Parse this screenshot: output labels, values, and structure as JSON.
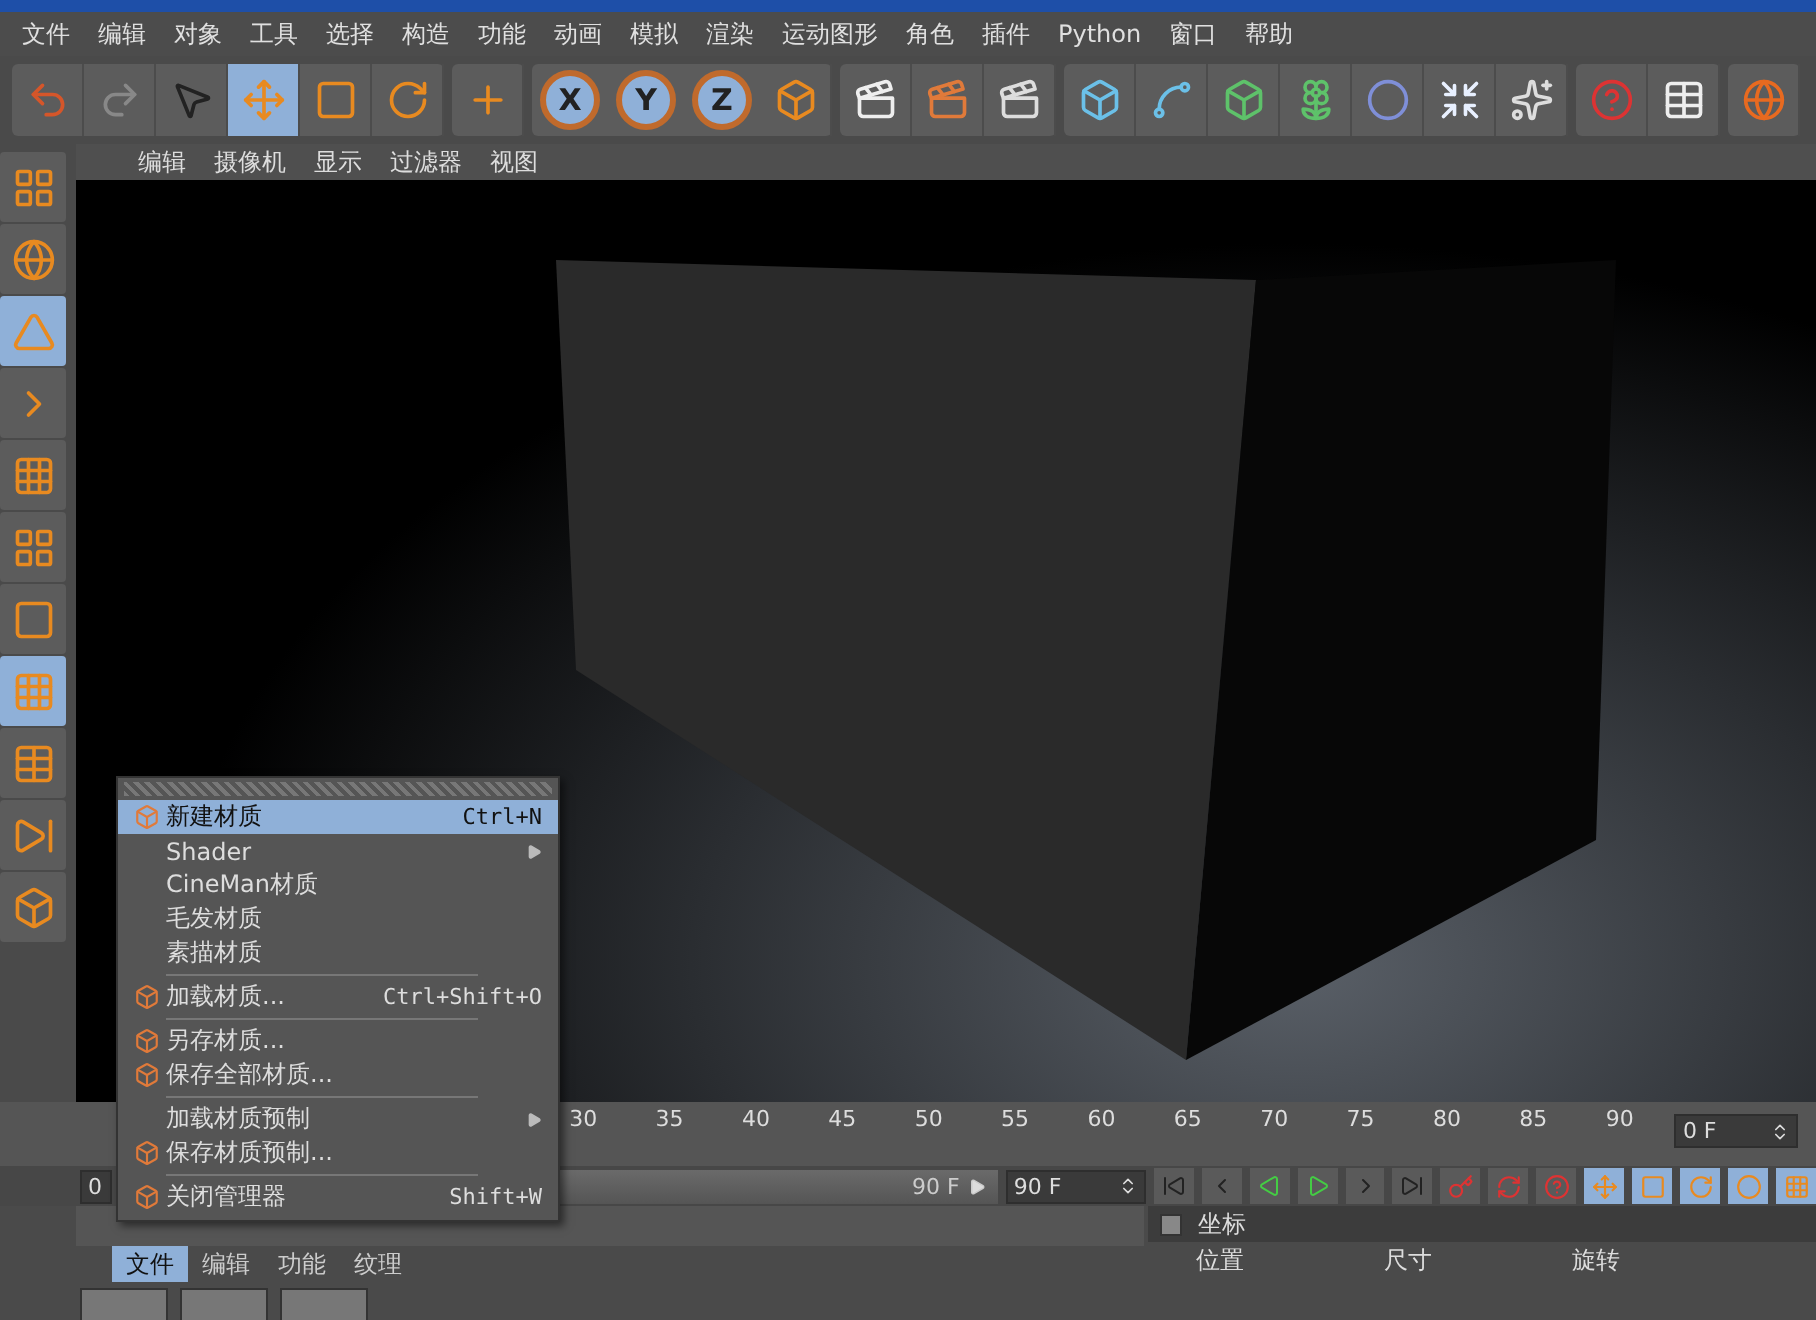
{
  "menu_bar": [
    "文件",
    "编辑",
    "对象",
    "工具",
    "选择",
    "构造",
    "功能",
    "动画",
    "模拟",
    "渲染",
    "运动图形",
    "角色",
    "插件",
    "Python",
    "窗口",
    "帮助"
  ],
  "toolbar": {
    "move_selected": true,
    "axes": [
      {
        "label": "X",
        "selected": true
      },
      {
        "label": "Y",
        "selected": true
      },
      {
        "label": "Z",
        "selected": true
      }
    ]
  },
  "left_toolbar": [
    {
      "selected": false
    },
    {
      "selected": false
    },
    {
      "selected": true
    },
    {
      "selected": false
    },
    {
      "selected": false
    },
    {
      "selected": false
    },
    {
      "selected": false
    },
    {
      "selected": true
    },
    {
      "selected": false
    },
    {
      "selected": false
    },
    {
      "selected": false
    }
  ],
  "viewport": {
    "menu": [
      "编辑",
      "摄像机",
      "显示",
      "过滤器",
      "视图"
    ]
  },
  "context_menu": {
    "items": [
      {
        "kind": "item",
        "label": "新建材质",
        "shortcut": "Ctrl+N",
        "selected": true,
        "icon": true,
        "submenu": false
      },
      {
        "kind": "item",
        "label": "Shader",
        "selected": false,
        "icon": false,
        "submenu": true
      },
      {
        "kind": "item",
        "label": "CineMan材质",
        "selected": false,
        "icon": false,
        "submenu": false
      },
      {
        "kind": "item",
        "label": "毛发材质",
        "selected": false,
        "icon": false,
        "submenu": false
      },
      {
        "kind": "item",
        "label": "素描材质",
        "selected": false,
        "icon": false,
        "submenu": false
      },
      {
        "kind": "separator"
      },
      {
        "kind": "item",
        "label": "加载材质...",
        "shortcut": "Ctrl+Shift+O",
        "selected": false,
        "icon": true,
        "submenu": false
      },
      {
        "kind": "separator"
      },
      {
        "kind": "item",
        "label": "另存材质...",
        "selected": false,
        "icon": true,
        "submenu": false
      },
      {
        "kind": "item",
        "label": "保存全部材质...",
        "selected": false,
        "icon": true,
        "submenu": false
      },
      {
        "kind": "separator"
      },
      {
        "kind": "item",
        "label": "加载材质预制",
        "selected": false,
        "icon": false,
        "submenu": true
      },
      {
        "kind": "item",
        "label": "保存材质预制...",
        "selected": false,
        "icon": true,
        "submenu": false
      },
      {
        "kind": "separator"
      },
      {
        "kind": "item",
        "label": "关闭管理器",
        "shortcut": "Shift+W",
        "selected": false,
        "icon": true,
        "submenu": false
      }
    ]
  },
  "timeline": {
    "ticks": [
      "30",
      "35",
      "40",
      "45",
      "50",
      "55",
      "60",
      "65",
      "70",
      "75",
      "80",
      "85",
      "90"
    ],
    "current_frame": "0 F",
    "start_field": "0",
    "range": {
      "label": "90 F",
      "level": 1
    },
    "end_field": "90 F"
  },
  "material_manager": {
    "menu": [
      {
        "label": "文件",
        "selected": true
      },
      {
        "label": "编辑",
        "selected": false
      },
      {
        "label": "功能",
        "selected": false
      },
      {
        "label": "纹理",
        "selected": false
      }
    ]
  },
  "coordinates": {
    "title": "坐标",
    "checked": false,
    "columns": [
      "位置",
      "尺寸",
      "旋转"
    ]
  }
}
